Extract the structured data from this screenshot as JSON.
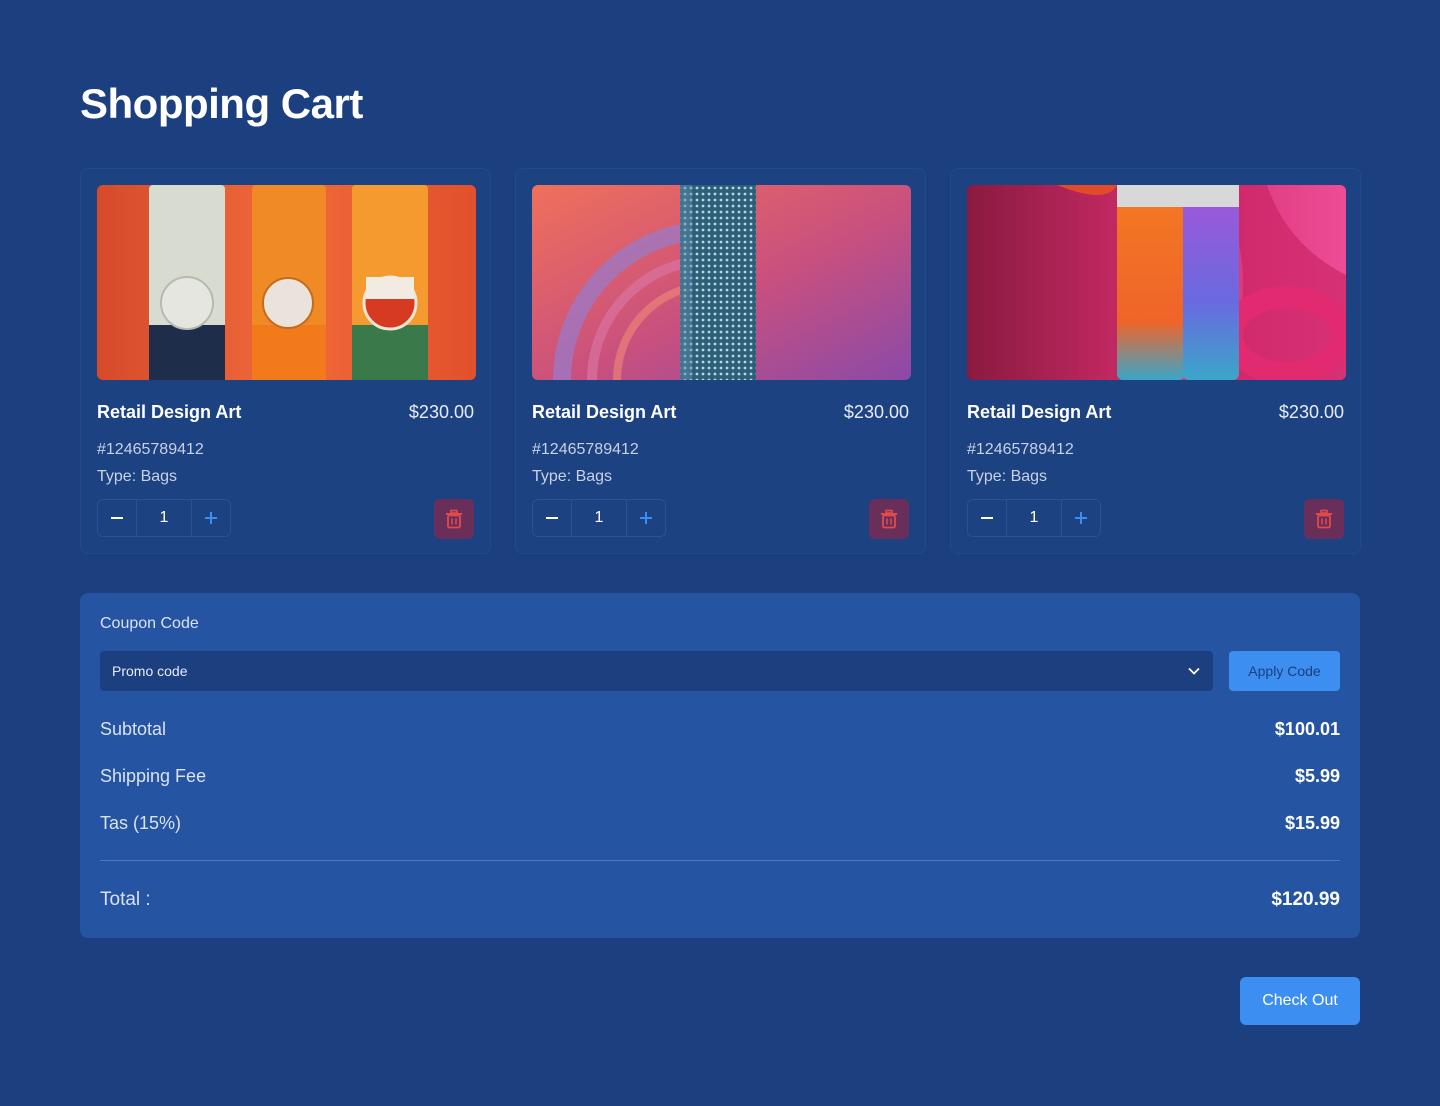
{
  "page": {
    "title": "Shopping Cart"
  },
  "cart": {
    "items": [
      {
        "name": "Retail Design Art",
        "price": "$230.00",
        "sku": "#12465789412",
        "type": "Type: Bags",
        "quantity": "1",
        "image": "orange-tube-packaging"
      },
      {
        "name": "Retail Design Art",
        "price": "$230.00",
        "sku": "#12465789412",
        "type": "Type: Bags",
        "quantity": "1",
        "image": "pink-speaker-render"
      },
      {
        "name": "Retail Design Art",
        "price": "$230.00",
        "sku": "#12465789412",
        "type": "Type: Bags",
        "quantity": "1",
        "image": "pink-bottle-packaging"
      }
    ]
  },
  "summary": {
    "coupon_label": "Coupon Code",
    "promo_placeholder": "Promo code",
    "apply_label": "Apply Code",
    "subtotal_label": "Subtotal",
    "subtotal_value": "$100.01",
    "shipping_label": "Shipping Fee",
    "shipping_value": "$5.99",
    "tax_label": "Tas (15%)",
    "tax_value": "$15.99",
    "total_label": "Total :",
    "total_value": "$120.99"
  },
  "actions": {
    "checkout_label": "Check Out"
  },
  "icons": {
    "minus": "minus-icon",
    "plus": "plus-icon",
    "delete": "trash-icon",
    "dropdown": "chevron-down-icon"
  },
  "colors": {
    "background": "#1b3f7f",
    "accent": "#3c8ef0",
    "danger": "#e04a4a",
    "panel": "#2554a2"
  }
}
